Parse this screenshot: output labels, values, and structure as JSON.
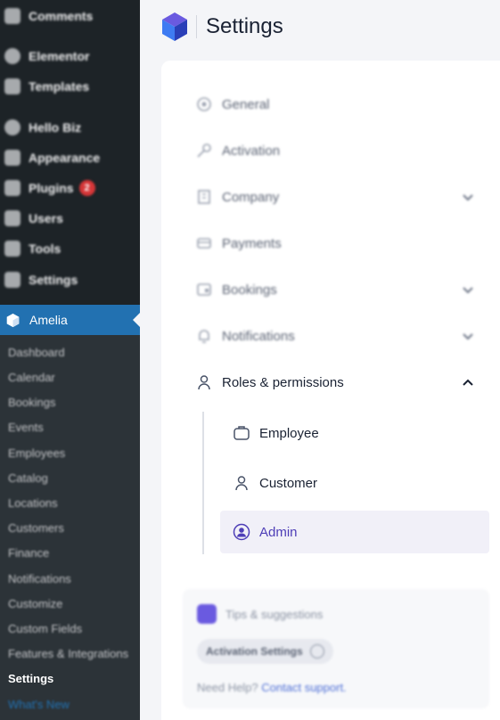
{
  "wp_menu": [
    {
      "label": "Comments",
      "icon": "comments-icon"
    },
    {
      "label": "Elementor",
      "icon": "elementor-icon"
    },
    {
      "label": "Templates",
      "icon": "templates-icon"
    },
    {
      "label": "Hello Biz",
      "icon": "hello-biz-icon"
    },
    {
      "label": "Appearance",
      "icon": "appearance-icon"
    },
    {
      "label": "Plugins",
      "icon": "plugins-icon",
      "badge": "2"
    },
    {
      "label": "Users",
      "icon": "users-icon"
    },
    {
      "label": "Tools",
      "icon": "tools-icon"
    },
    {
      "label": "Settings",
      "icon": "settings-icon"
    }
  ],
  "amelia_menu": {
    "label": "Amelia"
  },
  "amelia_submenu": [
    "Dashboard",
    "Calendar",
    "Bookings",
    "Events",
    "Employees",
    "Catalog",
    "Locations",
    "Customers",
    "Finance",
    "Notifications",
    "Customize",
    "Custom Fields",
    "Features & Integrations",
    "Settings",
    "What's New"
  ],
  "amelia_submenu_active": "Settings",
  "page": {
    "title": "Settings"
  },
  "settings_nav": [
    {
      "label": "General",
      "icon": "gear-icon"
    },
    {
      "label": "Activation",
      "icon": "key-icon"
    },
    {
      "label": "Company",
      "icon": "building-icon",
      "chevron": "down"
    },
    {
      "label": "Payments",
      "icon": "card-icon"
    },
    {
      "label": "Bookings",
      "icon": "wallet-icon",
      "chevron": "down"
    },
    {
      "label": "Notifications",
      "icon": "bell-icon",
      "chevron": "down"
    },
    {
      "label": "Roles & permissions",
      "icon": "user-icon",
      "chevron": "up"
    }
  ],
  "roles_subnav": [
    {
      "label": "Employee",
      "icon": "briefcase-icon"
    },
    {
      "label": "Customer",
      "icon": "user-icon"
    },
    {
      "label": "Admin",
      "icon": "user-circle-icon",
      "selected": true
    }
  ],
  "tips": {
    "title": "Tips & suggestions",
    "pill": "Activation Settings",
    "help_text": "Need Help?",
    "help_link": "Contact support."
  },
  "colors": {
    "accent": "#4e3eb7",
    "wp_blue": "#2271b1",
    "wp_dark": "#1d2327"
  }
}
